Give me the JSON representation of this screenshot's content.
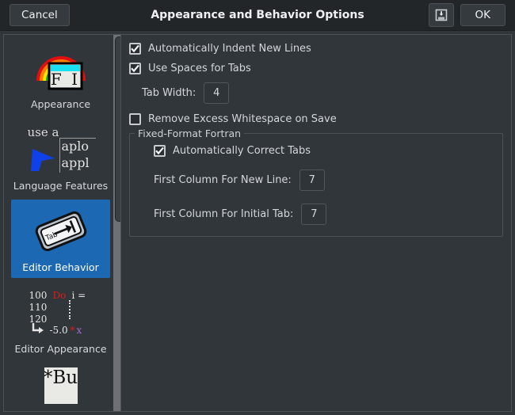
{
  "titlebar": {
    "cancel_label": "Cancel",
    "title": "Appearance and Behavior Options",
    "ok_label": "OK",
    "save_icon": "save-to-disk-icon"
  },
  "sidebar": {
    "items": [
      {
        "label": "Appearance",
        "icon": "rainbow-fi-icon",
        "selected": false
      },
      {
        "label": "Language Features",
        "icon": "autocomplete-cursor-icon",
        "selected": false
      },
      {
        "label": "Editor Behavior",
        "icon": "tab-key-icon",
        "selected": true
      },
      {
        "label": "Editor Appearance",
        "icon": "code-coloring-icon",
        "selected": false
      },
      {
        "label": "",
        "icon": "build-asterisk-icon",
        "selected": false
      }
    ],
    "icon_text": {
      "appearance_fi": "F I",
      "lang_use_a": "use a",
      "lang_line1": "aplo",
      "lang_line2": "appl",
      "tab_key": "Tab",
      "editor_appearance": {
        "l1_num": "100",
        "l1_kw": "Do",
        "l1_rest": "i =",
        "l2_num": "110",
        "l3_num": "120",
        "l4_val": "-5.0",
        "l4_op": "*",
        "l4_var": "x"
      },
      "build_label": "*Bu"
    },
    "scrollbar": "vertical-scrollbar"
  },
  "main": {
    "checkboxes": [
      {
        "label": "Automatically Indent New Lines",
        "checked": true
      },
      {
        "label": "Use Spaces for Tabs",
        "checked": true
      }
    ],
    "tab_width": {
      "label": "Tab Width:",
      "value": "4"
    },
    "remove_whitespace": {
      "label": "Remove Excess Whitespace on Save",
      "checked": false
    },
    "group": {
      "title": "Fixed-Format Fortran",
      "auto_correct": {
        "label": "Automatically Correct Tabs",
        "checked": true
      },
      "fields": [
        {
          "label": "First Column For New Line:",
          "value": "7"
        },
        {
          "label": "First Column For Initial Tab:",
          "value": "7"
        }
      ]
    }
  },
  "colors": {
    "window_bg": "#31363b",
    "titlebar_bg": "#232629",
    "selection_blue": "#1d68b3",
    "text": "#d7dadd",
    "border": "#4b5157",
    "cursor_blue": "#1040e8",
    "keyword_red": "#e01b1b"
  }
}
